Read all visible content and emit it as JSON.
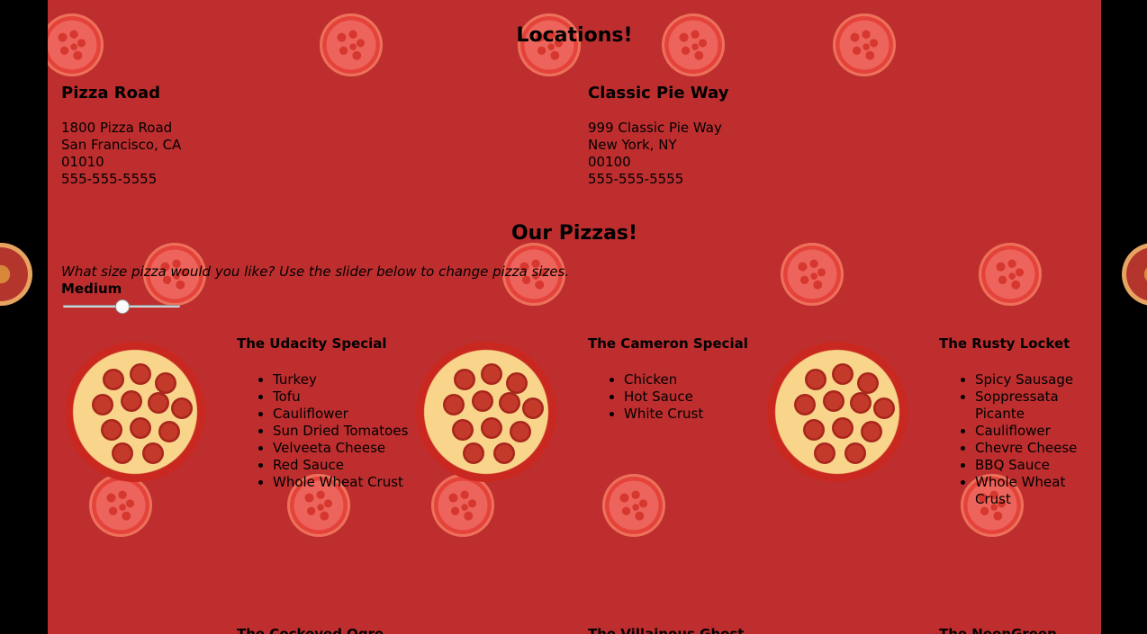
{
  "locations": {
    "heading": "Locations!",
    "items": [
      {
        "name": "Pizza Road",
        "street": "1800 Pizza Road",
        "city": "San Francisco, CA",
        "zip": "01010",
        "phone": "555-555-5555"
      },
      {
        "name": "Classic Pie Way",
        "street": "999 Classic Pie Way",
        "city": "New York, NY",
        "zip": "00100",
        "phone": "555-555-5555"
      }
    ]
  },
  "pizzas": {
    "heading": "Our Pizzas!",
    "prompt": "What size pizza would you like? Use the slider below to change pizza sizes.",
    "size_label": "Medium",
    "slider_value": 0.5,
    "items": [
      {
        "name": "The Udacity Special",
        "ingredients": [
          "Turkey",
          "Tofu",
          "Cauliflower",
          "Sun Dried Tomatoes",
          "Velveeta Cheese",
          "Red Sauce",
          "Whole Wheat Crust"
        ]
      },
      {
        "name": "The Cameron Special",
        "ingredients": [
          "Chicken",
          "Hot Sauce",
          "White Crust"
        ]
      },
      {
        "name": "The Rusty Locket",
        "ingredients": [
          "Spicy Sausage",
          "Soppressata Picante",
          "Cauliflower",
          "Chevre Cheese",
          "BBQ Sauce",
          "Whole Wheat Crust"
        ]
      }
    ],
    "next_row": [
      "The Cockeyed Ogre",
      "The Villainous Ghost",
      "The NeonGreen"
    ]
  },
  "colors": {
    "background": "#be2e2f",
    "page_bg": "#000000"
  },
  "icons": [
    "pizza-icon"
  ]
}
